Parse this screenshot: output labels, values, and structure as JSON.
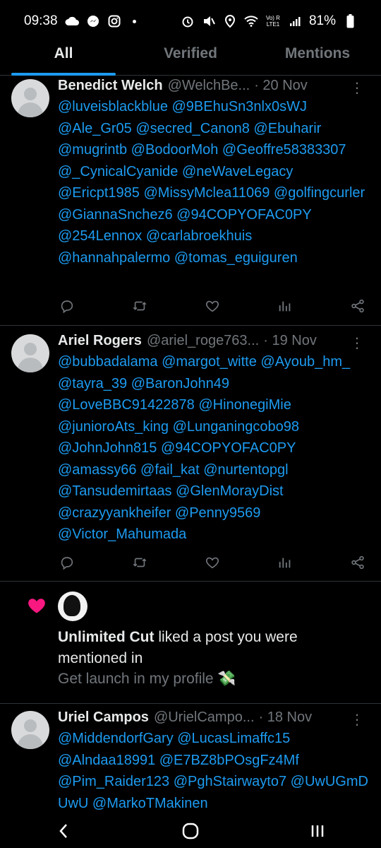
{
  "status_bar": {
    "time": "09:38",
    "battery": "81%",
    "icons_left": [
      "cloud-icon",
      "messenger-icon",
      "instagram-icon"
    ],
    "icons_right": [
      "alarm-icon",
      "mute-icon",
      "location-icon",
      "wifi-icon",
      "signal-icon",
      "battery-icon"
    ],
    "network": "Vo) R LTE1"
  },
  "tabs": [
    {
      "label": "All",
      "active": true
    },
    {
      "label": "Verified",
      "active": false
    },
    {
      "label": "Mentions",
      "active": false
    }
  ],
  "posts": [
    {
      "name": "Benedict Welch",
      "handle": "@WelchBe...",
      "date": "· 20 Nov",
      "mentions": "@luveisblackblue @9BEhuSn3nlx0sWJ @Ale_Gr05 @secred_Canon8 @Ebuharir @mugrintb @BodoorMoh @Geoffre58383307 @_CynicalCyanide @neWaveLegacy @Ericpt1985 @MissyMclea11069 @golfingcurler @GiannaSnchez6 @94COPYOFAC0PY @254Lennox @carlabroekhuis @hannahpalermo @tomas_eguiguren"
    },
    {
      "name": "Ariel Rogers",
      "handle": "@ariel_roge763...",
      "date": "· 19 Nov",
      "mentions": "@bubbadalama @margot_witte @Ayoub_hm_ @tayra_39 @BaronJohn49 @LoveBBC91422878 @HinonegiMie @junioroAts_king @Lunganingcobo98 @JohnJohn815 @94COPYOFAC0PY @amassy66 @fail_kat @nurtentopgl @Tansudemirtaas @GlenMorayDist @crazyyankheifer @Penny9569 @Victor_Mahumada"
    },
    {
      "name": "Uriel Campos",
      "handle": "@UrielCampo...",
      "date": "· 18 Nov",
      "mentions": "@MiddendorfGary @LucasLimaffc15 @Alndaa18991 @E7BZ8bPOsgFz4Mf @Pim_Raider123 @PghStairwayto7 @UwUGmD UwU @MarkoTMakinen"
    }
  ],
  "like_notification": {
    "user": "Unlimited Cut",
    "text": "liked a post you were mentioned in",
    "post_preview": "Get launch in my profile 💸"
  },
  "more_icon": "⋮",
  "colors": {
    "background": "#000000",
    "accent": "#1d9bf0",
    "muted": "#71767b",
    "heart": "#f91880"
  }
}
